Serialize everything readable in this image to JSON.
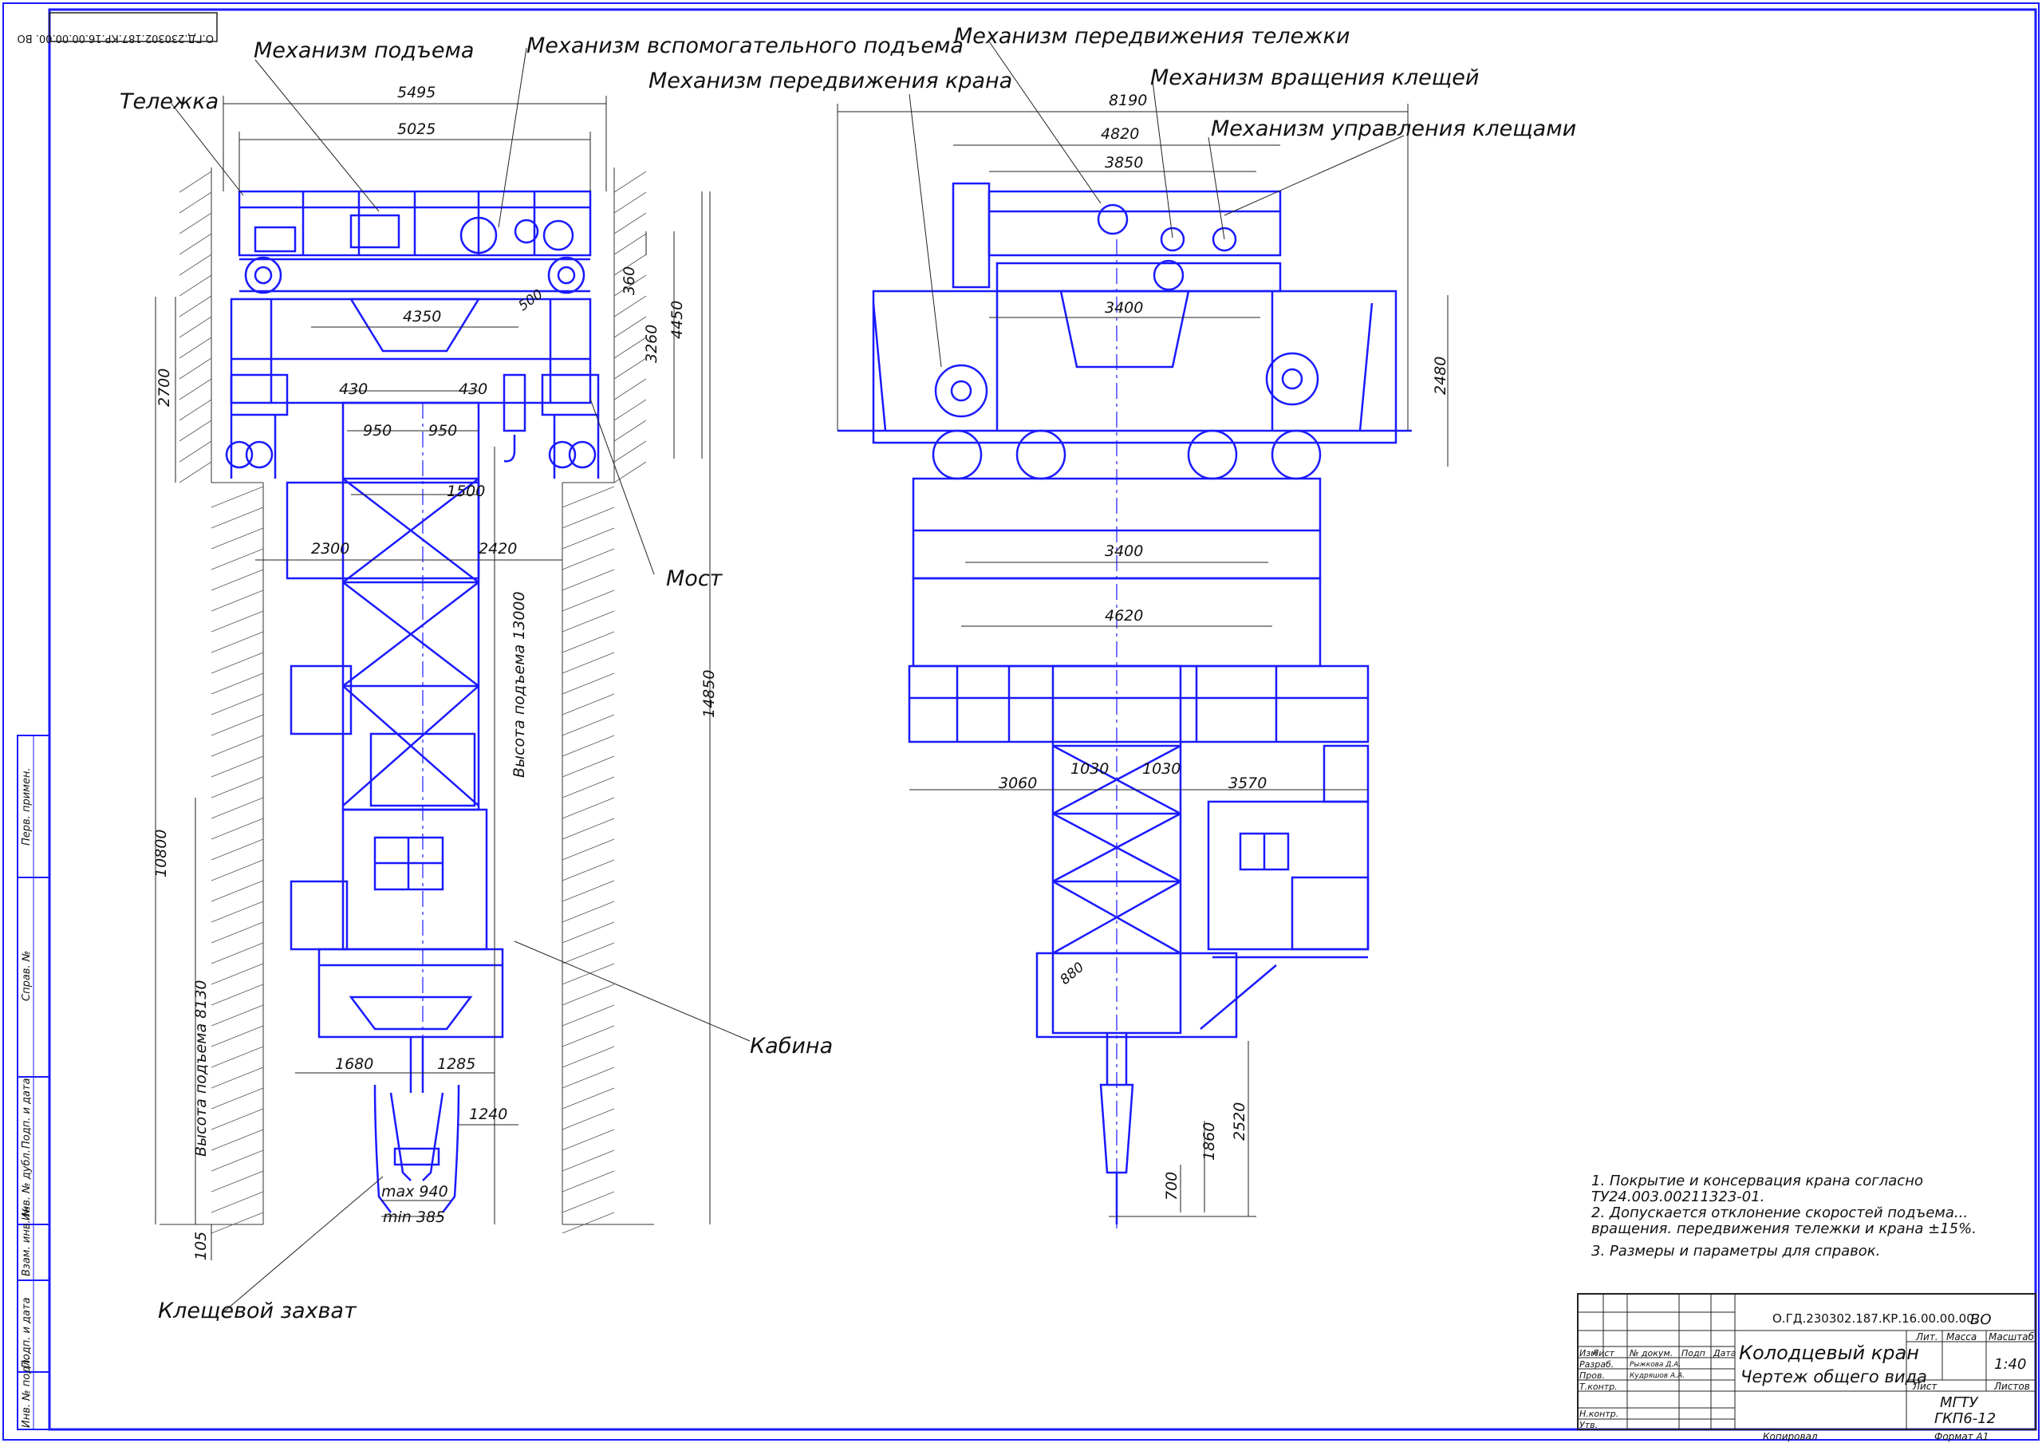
{
  "drawing_code_top": "О.ГД.230302.187.КР.16.00.00.00. ВО",
  "labels": {
    "lifting": "Механизм подъема",
    "aux_lifting": "Механизм вспомогательного подъема",
    "trolley": "Тележка",
    "crane_travel": "Механизм передвижения крана",
    "trolley_travel": "Механизм передвижения тележки",
    "tong_rotation": "Механизм вращения клещей",
    "tong_control": "Механизм управления клещами",
    "bridge": "Мост",
    "cabin": "Кабина",
    "tong_grab": "Клещевой захват"
  },
  "dims_left": {
    "d5495": "5495",
    "d5025": "5025",
    "d4350": "4350",
    "d430a": "430",
    "d430b": "430",
    "d950a": "950",
    "d950b": "950",
    "d1500": "1500",
    "d2300": "2300",
    "d2420": "2420",
    "d2700": "2700",
    "d360": "360",
    "d3260": "3260",
    "d4450": "4450",
    "d14850": "14850",
    "d10800": "10800",
    "d105": "105",
    "d1680": "1680",
    "d1285": "1285",
    "d1240": "1240",
    "d500": "500",
    "max": "max 940",
    "min": "min 385",
    "h13000": "Высота подъема 13000",
    "h8130": "Высота подъема 8130"
  },
  "dims_right": {
    "d8190": "8190",
    "d4820": "4820",
    "d3850": "3850",
    "d3400a": "3400",
    "d3400b": "3400",
    "d2480": "2480",
    "d4620": "4620",
    "d3060": "3060",
    "d1030a": "1030",
    "d1030b": "1030",
    "d3570": "3570",
    "d880": "880",
    "d2520": "2520",
    "d1860": "1860",
    "d700": "700"
  },
  "notes": [
    "1. Покрытие и консервация крана согласно",
    "ТУ24.003.00211323-01.",
    "2. Допускается отклонение скоростей подъема...",
    "вращения. передвижения тележки и крана ±15%.",
    "3. Размеры и параметры для справок."
  ],
  "side_stamp": {
    "perv_primen": "Перв. примен.",
    "sprav_no": "Справ. №",
    "podp_data1": "Подп. и дата",
    "inv_dubl": "Инв. № дубл.",
    "vzam_inv": "Взам. инв. №",
    "podp_data2": "Подп. и дата",
    "inv_podl": "Инв. № подл."
  },
  "title_block": {
    "code": "О.ГД.230302.187.КР.16.00.00.00.",
    "code_suffix": "ВО",
    "title1": "Колодцевый кран",
    "title2": "Чертеж общего вида",
    "izm": "Изм",
    "list": "Лист",
    "doc_no": "№ докум.",
    "podp": "Подп",
    "data": "Дата",
    "razrab": "Разраб.",
    "razrab_name": "Рыжкова Д.А.",
    "prov": "Пров.",
    "prov_name": "Кудряшов А.А.",
    "tkontr": "Т.контр.",
    "nkontr": "Н.контр.",
    "utv": "Утв.",
    "lit": "Лит.",
    "massa": "Масса",
    "masshtab": "Масштаб",
    "scale": "1:40",
    "sheet": "Лист",
    "sheets": "Листов",
    "org1": "МГТУ",
    "org2": "ГКП6-12",
    "kopiroval": "Копировал",
    "format": "Формат А1"
  }
}
